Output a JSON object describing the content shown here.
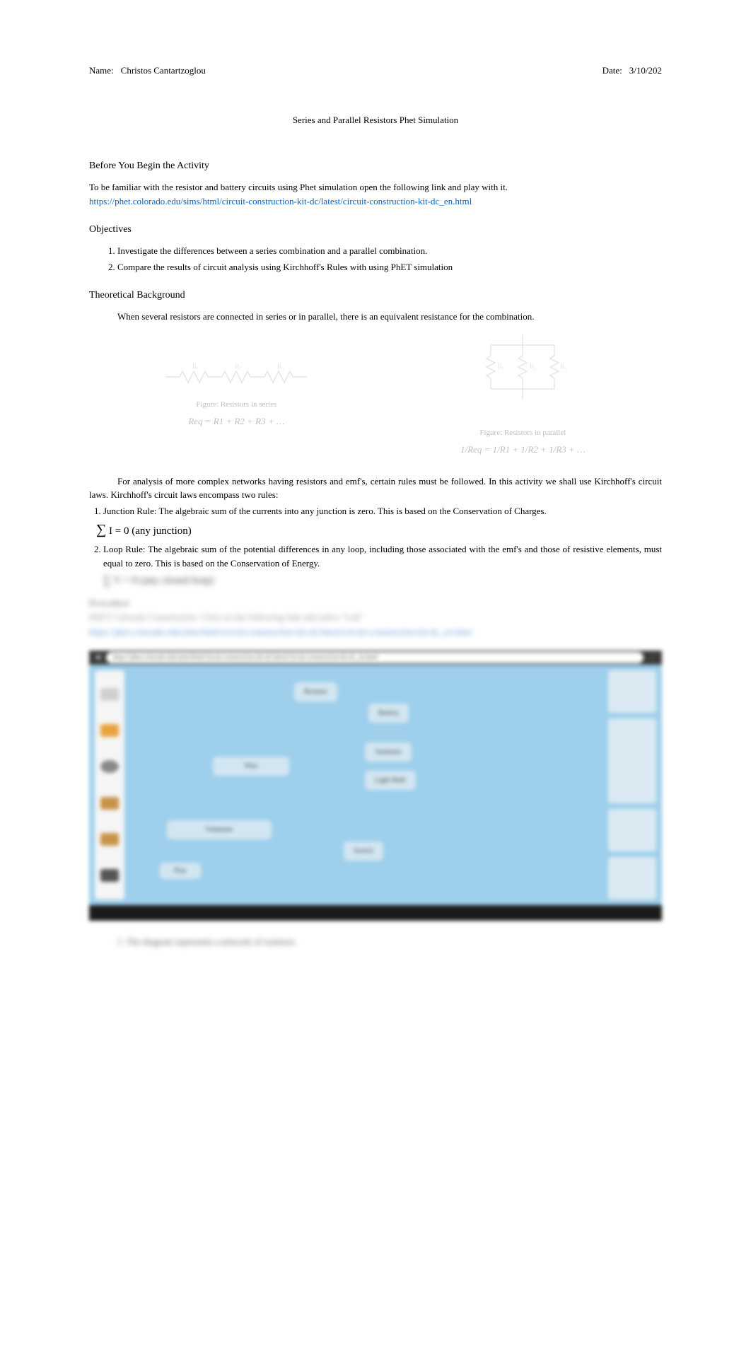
{
  "header": {
    "name_label": "Name:",
    "name_value": "Christos Cantartzoglou",
    "date_label": "Date:",
    "date_value": "3/10/202"
  },
  "title": "Series and Parallel Resistors Phet Simulation",
  "before": {
    "heading": "Before You Begin the Activity",
    "text": "To be familiar with the resistor and battery circuits using Phet simulation open the following link and play with it.",
    "link": "https://phet.colorado.edu/sims/html/circuit-construction-kit-dc/latest/circuit-construction-kit-dc_en.html"
  },
  "objectives": {
    "heading": "Objectives",
    "items": [
      "Investigate the differences between a series combination and a parallel combination.",
      "Compare the results of circuit analysis using Kirchhoff's Rules with using PhET simulation"
    ]
  },
  "theory": {
    "heading": "Theoretical Background",
    "intro": "When several resistors are connected in series or in parallel, there is an equivalent resistance for the combination.",
    "series_caption": "Figure: Resistors in series",
    "series_formula": "Req = R1 + R2 + R3 + …",
    "parallel_caption": "Figure: Resistors in parallel",
    "parallel_formula": "1/Req = 1/R1 + 1/R2 + 1/R3 + …",
    "kirchhoff_intro": "For analysis of more complex networks having resistors and emf's, certain rules must be followed. In this activity we shall use Kirchhoff's circuit laws. Kirchhoff's circuit laws encompass two rules:",
    "rules": [
      {
        "lead": "Junction Rule:",
        "body": " The algebraic sum of the currents into any junction is zero. This is based on the Conservation of Charges."
      },
      {
        "lead": "Loop Rule:",
        "body": " The algebraic sum of the potential differences in any loop, including those associated with the emf's and those of resistive elements, must equal to zero. This is based on the Conservation of Energy."
      }
    ],
    "junction_formula": "I = 0 (any junction)",
    "loop_formula": "V = 0 (any closed loop)"
  },
  "blurred": {
    "procedure": "Procedure",
    "line1": "PhET Colorado Construction: Click on the following link and select \"Lab\"",
    "link": "https://phet.colorado.edu/sims/html/circuit-construction-kit-dc/latest/circuit-construction-kit-dc_en.html",
    "caption": "1.   The diagram represents a network of resistors."
  },
  "sim_labels": {
    "top_center": "Resistor",
    "top_right": "Battery",
    "mid_left": "Wire",
    "mid_right1": "Ammeter",
    "mid_right2": "Light Bulb",
    "bottom_left": "Voltmeter",
    "bottom_right": "Switch",
    "play": "Play"
  }
}
